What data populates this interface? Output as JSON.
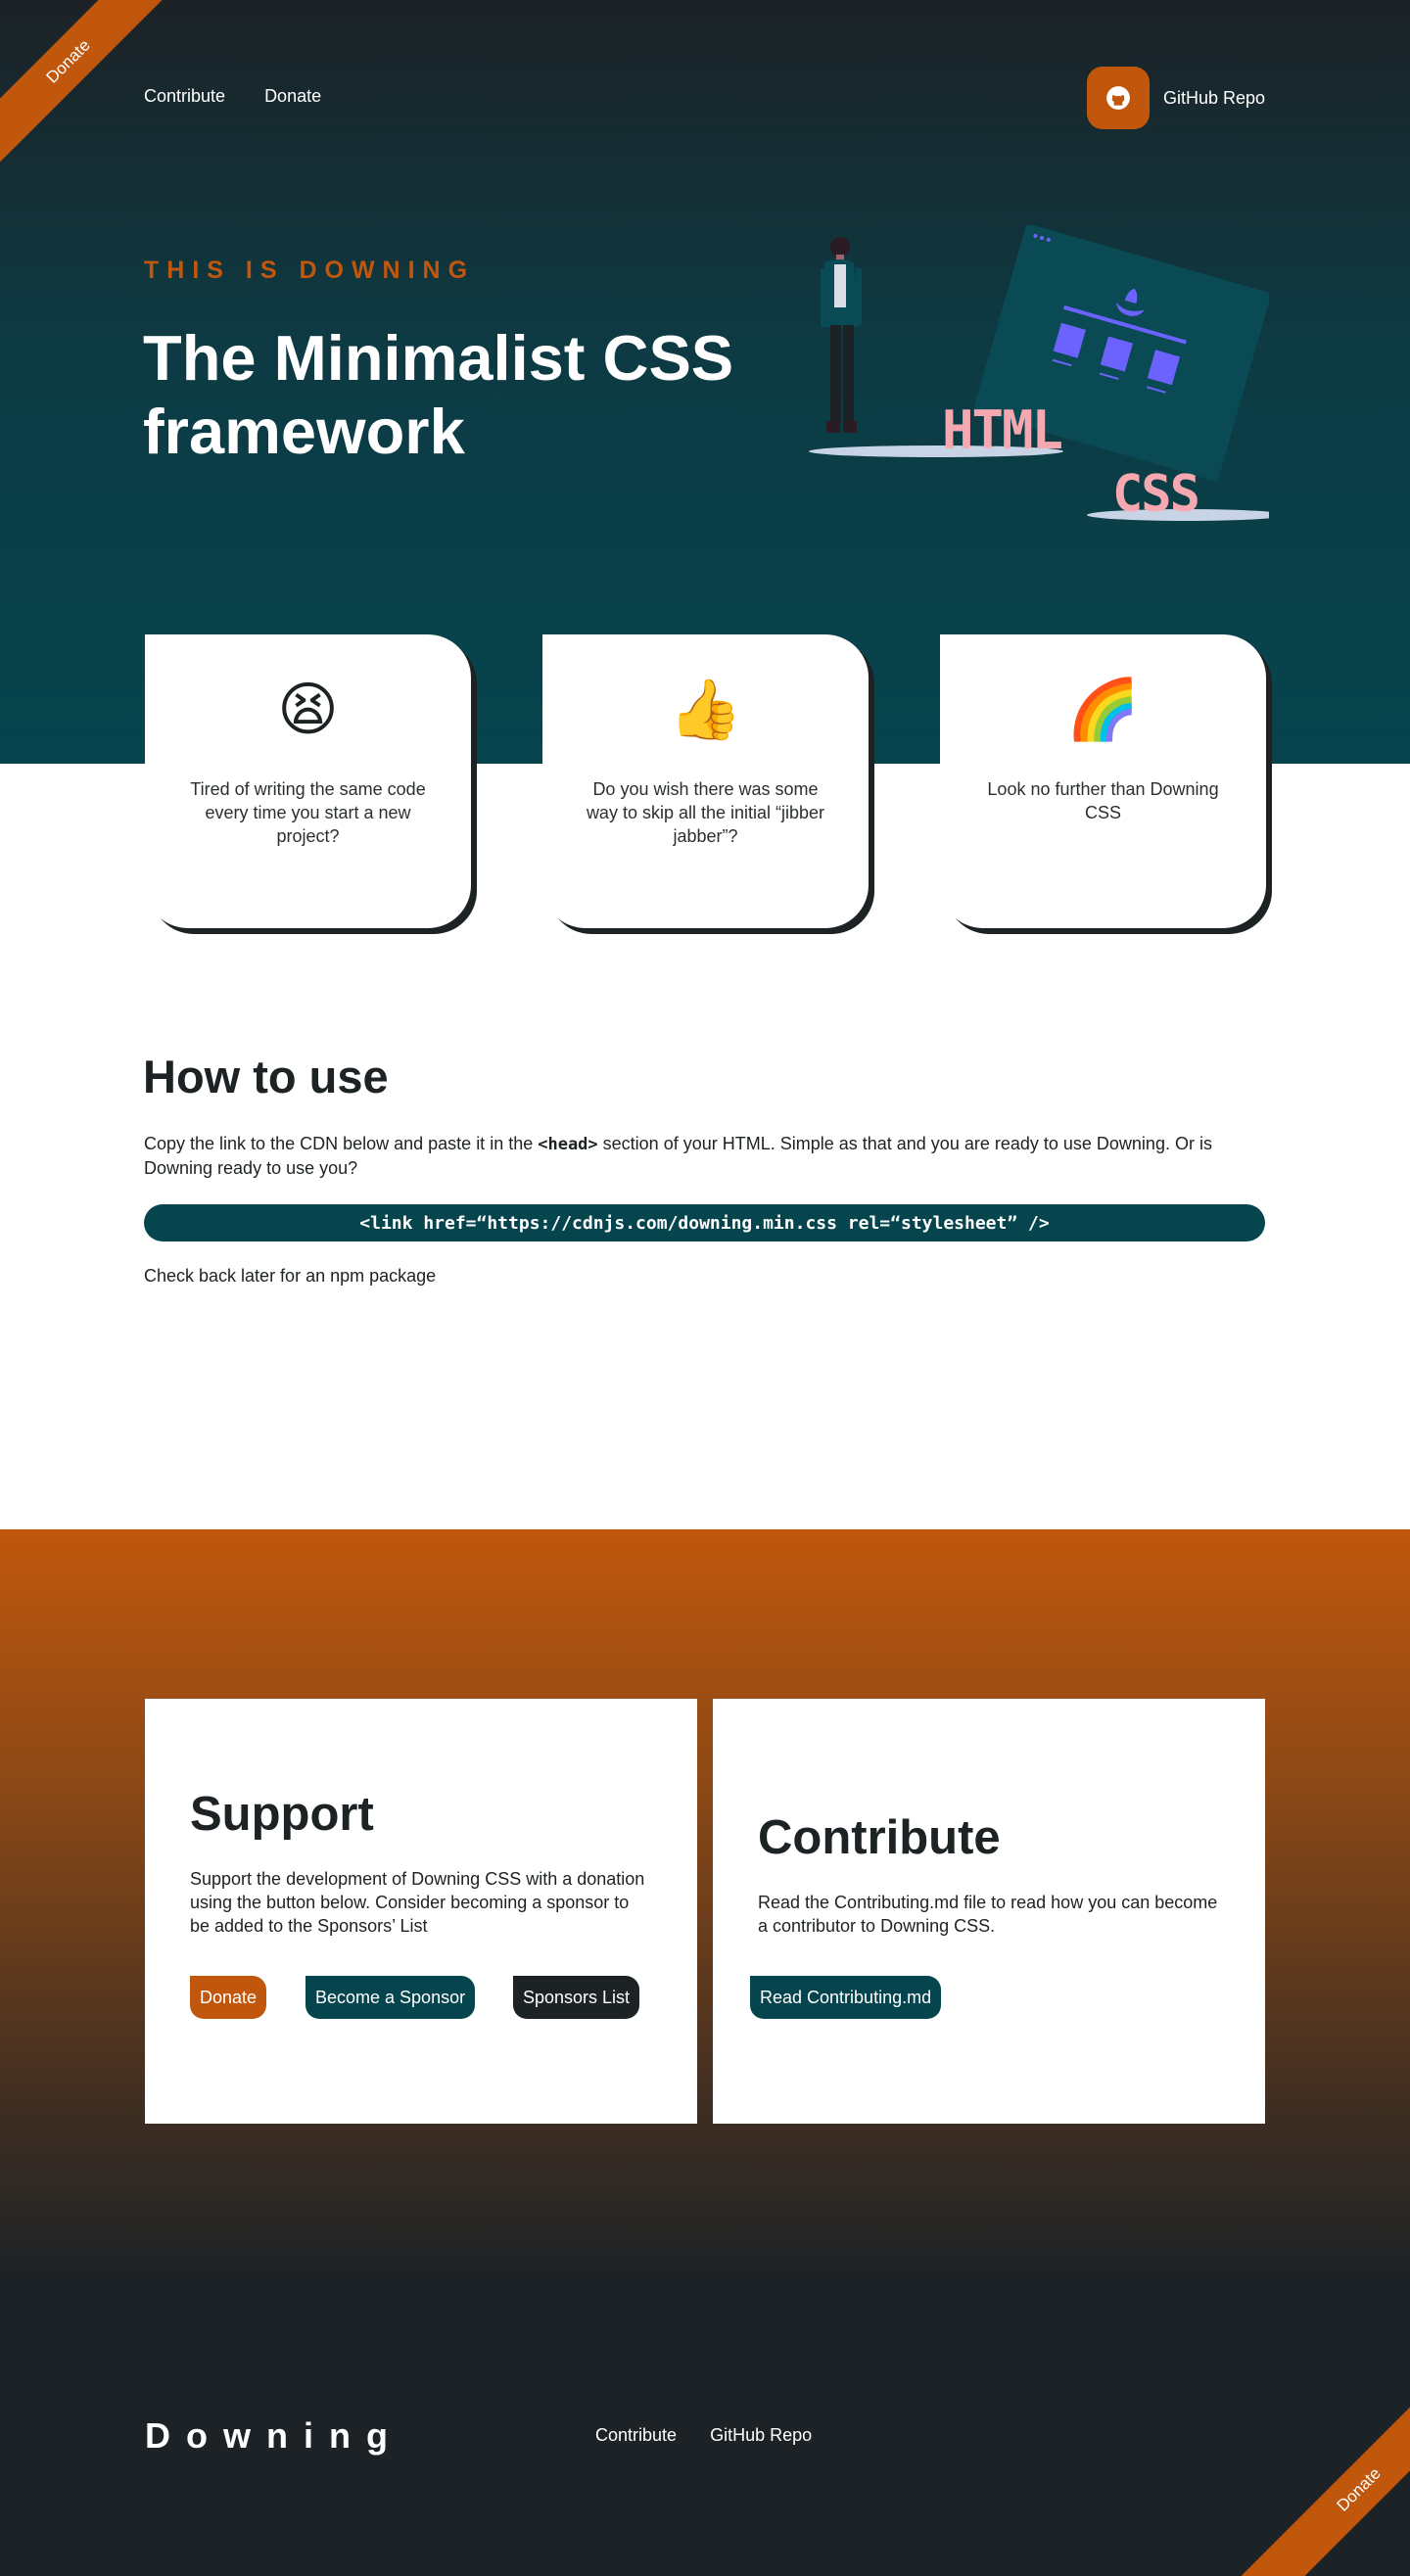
{
  "corner_ribbon_top": "Donate",
  "nav": {
    "items": [
      "Contribute",
      "Donate"
    ]
  },
  "github": {
    "label": "GitHub Repo",
    "icon": "github-icon"
  },
  "hero": {
    "eyebrow": "THIS IS DOWNING",
    "title": "The Minimalist CSS framework",
    "illustration": {
      "word_html": "HTML",
      "word_css": "CSS"
    }
  },
  "cards": [
    {
      "emoji": "😫",
      "icon": "tired-face-icon",
      "text": "Tired of writing the same code every time you  start a new project?"
    },
    {
      "emoji": "👍",
      "icon": "thumbs-up-icon",
      "text": "Do you wish there was some way to skip all the initial “jibber jabber”?"
    },
    {
      "emoji": "🌈",
      "icon": "rainbow-icon",
      "text": "Look no further than Downing CSS"
    }
  ],
  "howto": {
    "title": "How to use",
    "text_before": "Copy the link to the CDN below and paste it in the ",
    "text_code": "<head>",
    "text_after": " section of your HTML. Simple as that and you are ready to use Downing. Or is Downing ready to use you?",
    "cdn": "<link href=“https://cdnjs.com/downing.min.css rel=“stylesheet” />",
    "npm_note": "Check back later for an npm package"
  },
  "support": {
    "title": "Support",
    "text": "Support the development of Downing CSS with a donation using the button below. Consider becoming a sponsor to be added to the Sponsors’ List",
    "buttons": [
      "Donate",
      "Become a Sponsor",
      "Sponsors List"
    ]
  },
  "contribute": {
    "title": "Contribute",
    "text": "Read the Contributing.md file to read how you can become a contributor to Downing CSS.",
    "button": "Read Contributing.md"
  },
  "footer": {
    "logo": "Downing",
    "links": [
      "Contribute",
      "GitHub Repo"
    ],
    "corner_ribbon": "Donate"
  },
  "colors": {
    "orange": "#c0570d",
    "teal": "#06454e",
    "dark": "#1d2224",
    "pink": "#f6a8b0",
    "purple": "#6c63ff"
  }
}
